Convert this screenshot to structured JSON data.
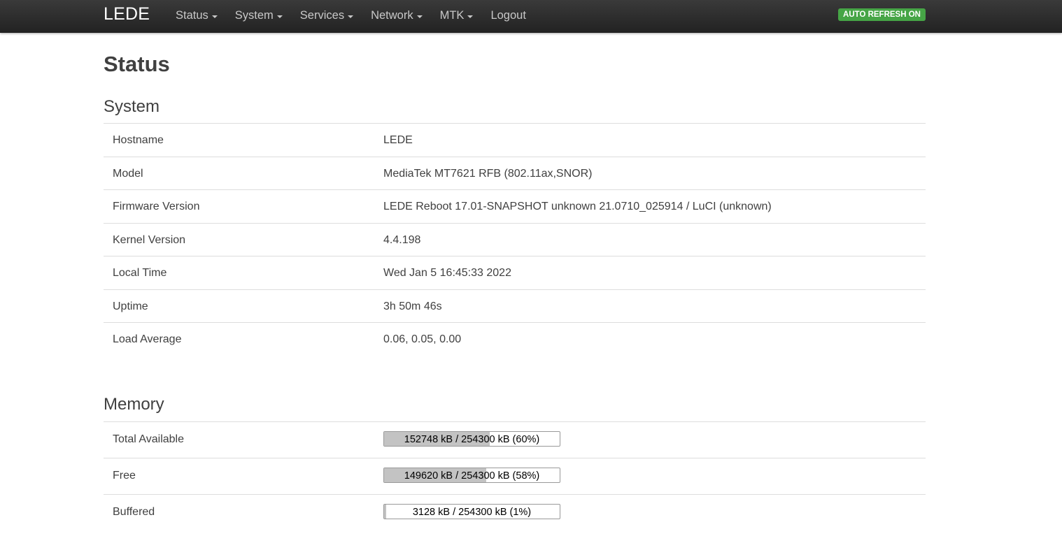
{
  "nav": {
    "brand": "LEDE",
    "menu": [
      "Status",
      "System",
      "Services",
      "Network",
      "MTK",
      "Logout"
    ],
    "auto_refresh": "AUTO REFRESH ON"
  },
  "page": {
    "title": "Status"
  },
  "system": {
    "title": "System",
    "rows": [
      {
        "label": "Hostname",
        "value": "LEDE"
      },
      {
        "label": "Model",
        "value": "MediaTek MT7621 RFB (802.11ax,SNOR)"
      },
      {
        "label": "Firmware Version",
        "value": "LEDE Reboot 17.01-SNAPSHOT unknown 21.0710_025914 / LuCI (unknown)"
      },
      {
        "label": "Kernel Version",
        "value": "4.4.198"
      },
      {
        "label": "Local Time",
        "value": "Wed Jan 5 16:45:33 2022"
      },
      {
        "label": "Uptime",
        "value": "3h 50m 46s"
      },
      {
        "label": "Load Average",
        "value": "0.06, 0.05, 0.00"
      }
    ]
  },
  "memory": {
    "title": "Memory",
    "rows": [
      {
        "label": "Total Available",
        "text": "152748 kB / 254300 kB (60%)",
        "percent": 60
      },
      {
        "label": "Free",
        "text": "149620 kB / 254300 kB (58%)",
        "percent": 58
      },
      {
        "label": "Buffered",
        "text": "3128 kB / 254300 kB (1%)",
        "percent": 1
      }
    ]
  }
}
